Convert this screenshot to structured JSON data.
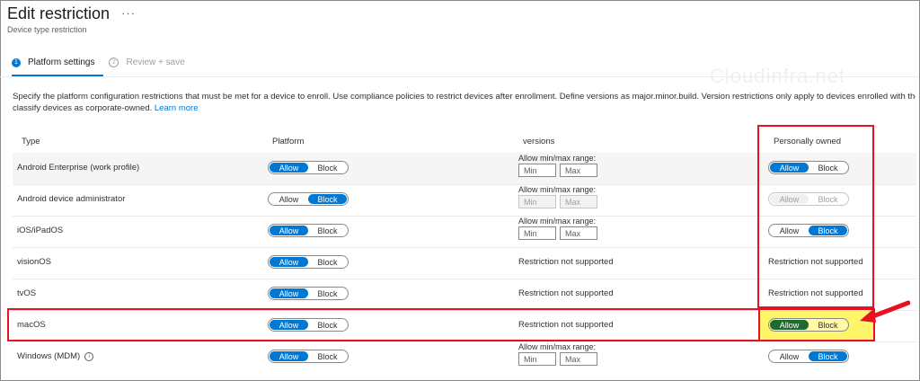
{
  "header": {
    "title": "Edit restriction",
    "more_label": "···",
    "subtitle": "Device type restriction"
  },
  "steps": [
    {
      "number": "1",
      "label": "Platform settings"
    },
    {
      "number": "2",
      "label": "Review + save"
    }
  ],
  "watermark": "Cloudinfra.net",
  "description": {
    "line1": "Specify the platform configuration restrictions that must be met for a device to enroll. Use compliance policies to restrict devices after enrollment. Define versions as major.minor.build. Version restrictions only apply to devices enrolled with the Company",
    "line2": "classify devices as corporate-owned.",
    "learn_more": "Learn more"
  },
  "columns": {
    "type": "Type",
    "platform": "Platform",
    "versions": "versions",
    "personally_owned": "Personally owned"
  },
  "labels": {
    "allow": "Allow",
    "block": "Block",
    "range": "Allow min/max range:",
    "min": "Min",
    "max": "Max",
    "not_supported": "Restriction not supported"
  },
  "rows": [
    {
      "type": "Android Enterprise (work profile)",
      "platform": "Allow",
      "versions": "range",
      "personal": "Allow"
    },
    {
      "type": "Android device administrator",
      "platform": "Block",
      "versions": "range-disabled",
      "personal": "Allow (disabled)"
    },
    {
      "type": "iOS/iPadOS",
      "platform": "Allow",
      "versions": "range",
      "personal": "Block"
    },
    {
      "type": "visionOS",
      "platform": "Allow",
      "versions": "Restriction not supported",
      "personal": "Restriction not supported"
    },
    {
      "type": "tvOS",
      "platform": "Allow",
      "versions": "Restriction not supported",
      "personal": "Restriction not supported"
    },
    {
      "type": "macOS",
      "platform": "Allow",
      "versions": "Restriction not supported",
      "personal": "Allow"
    },
    {
      "type": "Windows (MDM)",
      "platform": "Allow",
      "versions": "range",
      "personal": "Block"
    }
  ],
  "colors": {
    "accent": "#0078d4",
    "highlight_red": "#e81123",
    "highlight_yellow": "#fff56a",
    "allow_highlight": "#1e6b2e"
  }
}
